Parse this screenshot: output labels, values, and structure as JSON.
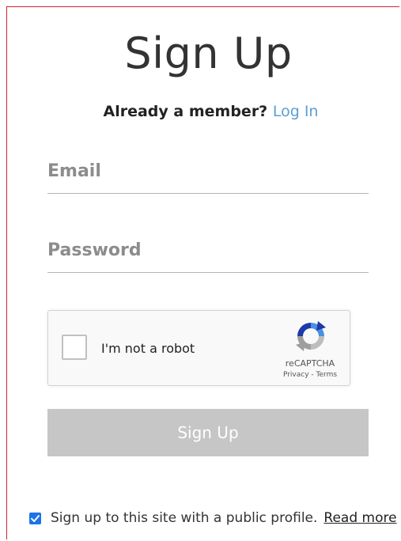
{
  "header": {
    "title": "Sign Up",
    "member_prompt": "Already a member?",
    "login_link": "Log In"
  },
  "form": {
    "email": {
      "placeholder": "Email",
      "value": ""
    },
    "password": {
      "placeholder": "Password",
      "value": ""
    }
  },
  "captcha": {
    "label": "I'm not a robot",
    "brand": "reCAPTCHA",
    "privacy": "Privacy",
    "separator": " - ",
    "terms": "Terms",
    "icon": "recaptcha-logo-icon"
  },
  "submit": {
    "label": "Sign Up"
  },
  "public_profile": {
    "checked": true,
    "label": "Sign up to this site with a public profile.",
    "read_more": "Read more"
  },
  "colors": {
    "accent_link": "#5a9fd6",
    "button_disabled": "#c6c6c6",
    "checkbox_blue": "#1a73e8",
    "frame_border": "#d3242d"
  }
}
